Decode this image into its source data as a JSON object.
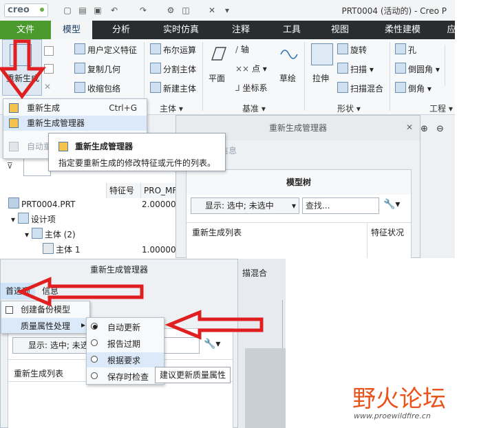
{
  "titlebar": {
    "logo": "creo",
    "window_title": "PRT0004 (活动的) - Creo P"
  },
  "tabs": [
    "文件",
    "模型",
    "分析",
    "实时仿真",
    "注释",
    "工具",
    "视图",
    "柔性建模",
    "应"
  ],
  "ribbon": {
    "regen_label": "重新生成",
    "ops": [
      "用户定义特征",
      "复制几何",
      "收缩包络"
    ],
    "ops2": [
      "布尔运算",
      "分割主体",
      "新建主体"
    ],
    "group_body": "主体",
    "datum": [
      "平面",
      "轴",
      "点",
      "坐标系",
      "草绘"
    ],
    "group_datum": "基准",
    "shapes": [
      "拉伸",
      "旋转",
      "扫描",
      "扫描混合"
    ],
    "group_shape": "形状",
    "eng": [
      "孔",
      "倒圆角",
      "倒角"
    ],
    "group_eng": "工程"
  },
  "regen_menu": {
    "items": [
      {
        "label": "重新生成",
        "shortcut": "Ctrl+G"
      },
      {
        "label": "重新生成管理器",
        "shortcut": ""
      },
      {
        "label": "自动重",
        "shortcut": ""
      }
    ]
  },
  "tooltip": {
    "title": "重新生成管理器",
    "text": "指定要重新生成的修改特征或元件的列表。"
  },
  "tree": {
    "col_feature_no": "特征号",
    "col_pro": "PRO_MF",
    "rows": [
      {
        "label": "PRT0004.PRT",
        "value": "2.000000"
      },
      {
        "label": "设计项",
        "value": ""
      },
      {
        "label": "主体 (2)",
        "value": ""
      },
      {
        "label": "主体 1",
        "value": "1.000000"
      }
    ]
  },
  "dialog_top": {
    "title": "重新生成管理器",
    "tab_info": "信息",
    "panel_title": "模型树",
    "display_value": "显示: 选中; 未选中",
    "search_placeholder": "查找...",
    "col_list": "重新生成列表",
    "col_status": "特征状况"
  },
  "dialog_bottom": {
    "title": "重新生成管理器",
    "tab_prefs": "首选项",
    "tab_info": "信息",
    "backup_label": "创建备份模型",
    "mass_label": "质量属性处理",
    "display_value": "显示: 选中; 未选",
    "col_list": "重新生成列表",
    "bg_label": "描混合",
    "options": [
      {
        "label": "自动更新",
        "selected": true
      },
      {
        "label": "报告过期",
        "selected": false
      },
      {
        "label": "根据要求",
        "selected": false
      },
      {
        "label": "保存时检查",
        "selected": false
      }
    ],
    "option_tip": "建议更新质量属性"
  },
  "watermark": {
    "text": "野火论坛",
    "url": "www.proewildfire.cn"
  },
  "colors": {
    "file_tab": "#4a9a2e",
    "tabbar": "#2a2d30",
    "highlight": "#dbe9f8",
    "arrow": "#e02020",
    "watermark_orange": "#e8541c"
  }
}
